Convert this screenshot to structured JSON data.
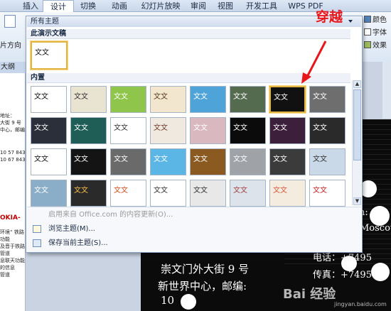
{
  "ribbon": {
    "tabs": [
      "插入",
      "设计",
      "切换",
      "动画",
      "幻灯片放映",
      "审阅",
      "视图",
      "开发工具",
      "WPS PDF"
    ],
    "active_tab": "设计",
    "left_label": "片方向",
    "right_items": [
      "颜色",
      "字体",
      "效果"
    ]
  },
  "left_pane": {
    "header": "大纲",
    "lines": [
      "地址：",
      "大街 9 号",
      "中心，邮编",
      "",
      "10 57 843",
      "10 67 843"
    ],
    "red_line": "OKIA-",
    "lines2": [
      "",
      "环境“ 铁路",
      "功能",
      "及音于铁路",
      "管道",
      "息联天功能",
      "的信息",
      "管道"
    ]
  },
  "slide": {
    "line1": "崇文门外大街 9 号",
    "line2": "新世界中心，邮编:",
    "line3": "10",
    "right1": "Moscow",
    "right2": "电话：+7495",
    "right3": "传真：+7495",
    "right4": "n:"
  },
  "theme_gallery": {
    "header": "所有主题",
    "section_current": "此演示文稿",
    "section_builtin": "内置",
    "menu": {
      "update": "启用来自 Office.com 的内容更新(O)...",
      "browse": "浏览主题(M)...",
      "save": "保存当前主题(S)..."
    },
    "current_theme": {
      "text": "文文",
      "bg": "#ffffff",
      "fg": "#111111"
    },
    "builtin_themes": [
      {
        "text": "文文",
        "bg": "#ffffff",
        "fg": "#111111"
      },
      {
        "text": "文文",
        "bg": "#e9e3d2",
        "fg": "#333333"
      },
      {
        "text": "文文",
        "bg": "#8fc54a",
        "fg": "#ffffff"
      },
      {
        "text": "文文",
        "bg": "#f2e6cf",
        "fg": "#5a3c1c"
      },
      {
        "text": "文文",
        "bg": "#4ea4d8",
        "fg": "#ffffff"
      },
      {
        "text": "文文",
        "bg": "#556b4f",
        "fg": "#ffffff"
      },
      {
        "text": "文文",
        "bg": "#111111",
        "fg": "#ffffff"
      },
      {
        "text": "文文",
        "bg": "#6e6e6e",
        "fg": "#ffffff"
      },
      {
        "text": "文文",
        "bg": "#2b2f3a",
        "fg": "#ffffff"
      },
      {
        "text": "文文",
        "bg": "#1e5e57",
        "fg": "#ffffff"
      },
      {
        "text": "文文",
        "bg": "#ffffff",
        "fg": "#333333"
      },
      {
        "text": "文文",
        "bg": "#f0e9e0",
        "fg": "#6b3a2a"
      },
      {
        "text": "文文",
        "bg": "#d9b8c0",
        "fg": "#ffffff"
      },
      {
        "text": "文文",
        "bg": "#0b0b0b",
        "fg": "#ffffff"
      },
      {
        "text": "文文",
        "bg": "#3c1f3a",
        "fg": "#ffffff"
      },
      {
        "text": "文文",
        "bg": "#2a2a2a",
        "fg": "#ffffff"
      },
      {
        "text": "文文",
        "bg": "#ffffff",
        "fg": "#111111"
      },
      {
        "text": "文文",
        "bg": "#141414",
        "fg": "#ffffff"
      },
      {
        "text": "文文",
        "bg": "#6a6a6a",
        "fg": "#ffffff"
      },
      {
        "text": "文文",
        "bg": "#5bb5e5",
        "fg": "#ffffff"
      },
      {
        "text": "文文",
        "bg": "#8a5a20",
        "fg": "#ffffff"
      },
      {
        "text": "文文",
        "bg": "#9fa3a8",
        "fg": "#ffffff"
      },
      {
        "text": "文文",
        "bg": "#3b3b3b",
        "fg": "#ffffff"
      },
      {
        "text": "文文",
        "bg": "#c9d9e8",
        "fg": "#333333"
      },
      {
        "text": "文文",
        "bg": "#8aaec8",
        "fg": "#ffffff"
      },
      {
        "text": "文文",
        "bg": "#2a2a2a",
        "fg": "#f7c04a"
      },
      {
        "text": "文文",
        "bg": "#ffffff",
        "fg": "#d04a1a"
      },
      {
        "text": "文文",
        "bg": "#ffffff",
        "fg": "#333333"
      },
      {
        "text": "文文",
        "bg": "#e8e8e8",
        "fg": "#333333"
      },
      {
        "text": "文文",
        "bg": "#dde3ea",
        "fg": "#a04040"
      },
      {
        "text": "文文",
        "bg": "#f5ece0",
        "fg": "#d6553a"
      },
      {
        "text": "文文",
        "bg": "#ffffff",
        "fg": "#c02020"
      },
      {
        "text": "文文",
        "bg": "#2a2d33",
        "fg": "#e0b040"
      }
    ],
    "selected_index": 6,
    "swatch_colors": [
      "#c0504d",
      "#4f81bd",
      "#9bbb59",
      "#8064a2",
      "#f79646",
      "#4bacc6"
    ]
  },
  "annotation": "穿越",
  "watermark": {
    "main": "Bai 经验",
    "url": "jingyan.baidu.com"
  }
}
